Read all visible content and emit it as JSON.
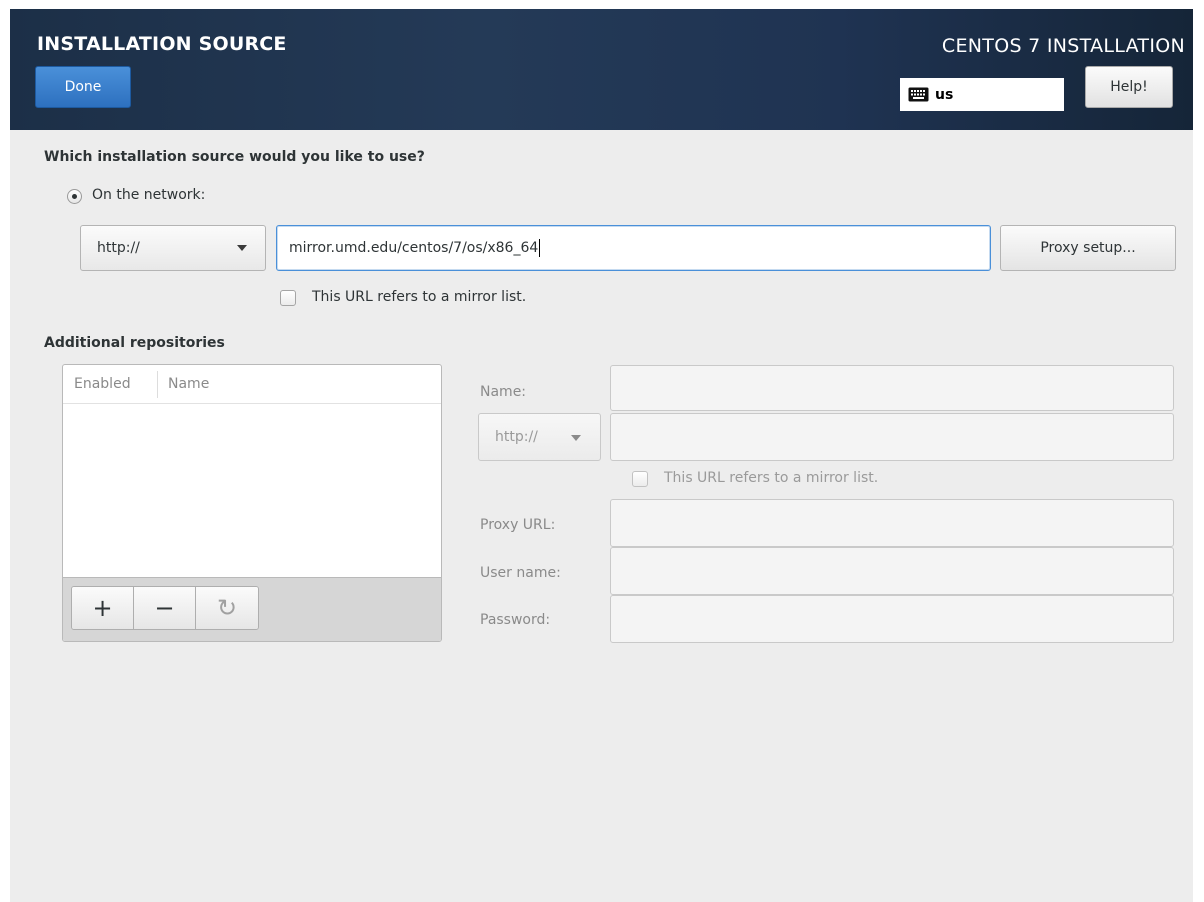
{
  "header": {
    "title": "INSTALLATION SOURCE",
    "done_label": "Done",
    "product": "CENTOS 7 INSTALLATION",
    "keyboard_layout": "us",
    "help_label": "Help!"
  },
  "source": {
    "question": "Which installation source would you like to use?",
    "network_option": "On the network:",
    "protocol": "http://",
    "url": "mirror.umd.edu/centos/7/os/x86_64",
    "proxy_button": "Proxy setup...",
    "mirror_list_label": "This URL refers to a mirror list."
  },
  "repos": {
    "heading": "Additional repositories",
    "columns": {
      "enabled": "Enabled",
      "name": "Name"
    },
    "toolbar": {
      "add": "+",
      "remove": "−",
      "reset": "↻"
    }
  },
  "repo_form": {
    "name_label": "Name:",
    "protocol": "http://",
    "mirror_list_label": "This URL refers to a mirror list.",
    "proxy_url_label": "Proxy URL:",
    "username_label": "User name:",
    "password_label": "Password:"
  }
}
